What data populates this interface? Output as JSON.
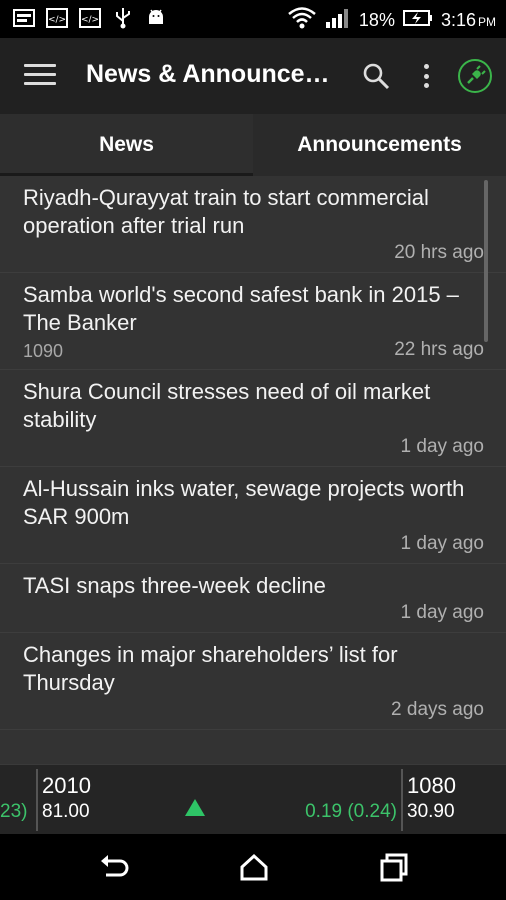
{
  "status_bar": {
    "battery_percent": "18%",
    "time": "3:16",
    "ampm": "PM"
  },
  "app_bar": {
    "title": "News & Announce…"
  },
  "tabs": [
    {
      "label": "News",
      "active": true
    },
    {
      "label": "Announcements",
      "active": false
    }
  ],
  "news": [
    {
      "title": "Riyadh-Qurayyat train to start commercial operation after trial run",
      "code": "",
      "time": "20 hrs ago"
    },
    {
      "title": "Samba world's second safest bank in 2015 – The Banker",
      "code": "1090",
      "time": "22 hrs ago"
    },
    {
      "title": "Shura Council stresses need of oil market stability",
      "code": "",
      "time": "1 day ago"
    },
    {
      "title": "Al-Hussain inks water, sewage projects worth SAR 900m",
      "code": "",
      "time": "1 day ago"
    },
    {
      "title": "TASI snaps three-week decline",
      "code": "",
      "time": "1 day ago"
    },
    {
      "title": "Changes in major shareholders’ list for Thursday",
      "code": "",
      "time": "2 days ago"
    }
  ],
  "ticker": {
    "left_change": "23)",
    "items": [
      {
        "code": "2010",
        "price": "81.00",
        "change": "0.19 (0.24)",
        "direction": "up"
      },
      {
        "code": "1080",
        "price": "30.90"
      }
    ]
  },
  "colors": {
    "accent_green": "#3bb54a",
    "ticker_up": "#3cc36a"
  }
}
